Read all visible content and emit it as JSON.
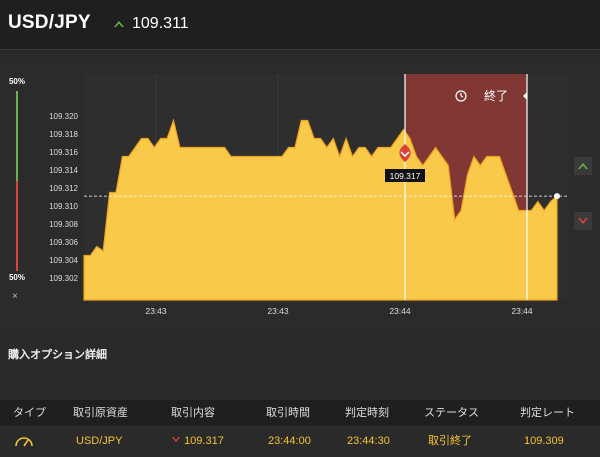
{
  "header": {
    "pair": "USD/JPY",
    "price": "109.311"
  },
  "gauge": {
    "top_label": "50%",
    "bottom_label": "50%",
    "close_glyph": "×"
  },
  "chart": {
    "y_ticks": [
      "109.320",
      "109.318",
      "109.316",
      "109.314",
      "109.312",
      "109.310",
      "109.308",
      "109.306",
      "109.304",
      "109.302"
    ],
    "x_ticks": [
      "23:43",
      "23:43",
      "23:44",
      "23:44"
    ],
    "entry_price_label": "109.317",
    "expiry_label": "終了",
    "colors": {
      "area": "#f9c94a",
      "area_stroke": "#f0a020",
      "expired_zone": "#8b3a36",
      "up": "#6ab04c",
      "down": "#d9443a"
    }
  },
  "chart_data": {
    "type": "area",
    "title": "",
    "xlabel": "",
    "ylabel": "",
    "ylim": [
      109.3,
      109.321
    ],
    "series": [
      {
        "values": [
          109.3045,
          109.3045,
          109.3055,
          109.305,
          109.3115,
          109.3115,
          109.3155,
          109.3155,
          109.3165,
          109.3175,
          109.3175,
          109.3165,
          109.3175,
          109.3175,
          109.3195,
          109.3165,
          109.3165,
          109.3165,
          109.3165,
          109.3165,
          109.3165,
          109.3165,
          109.3165,
          109.3155,
          109.3155,
          109.3155,
          109.3155,
          109.3155,
          109.3155,
          109.3155,
          109.3155,
          109.3155,
          109.3165,
          109.3165,
          109.3195,
          109.3195,
          109.3175,
          109.3175,
          109.3165,
          109.3175,
          109.3155,
          109.3175,
          109.3155,
          109.3165,
          109.3165,
          109.3155,
          109.3165,
          109.3165,
          109.3165,
          109.3175,
          109.3185,
          109.3175,
          109.3155,
          109.3145,
          109.3155,
          109.3165,
          109.3155,
          109.3145,
          109.3085,
          109.3095,
          109.3135,
          109.3155,
          109.3145,
          109.3155,
          109.3155,
          109.3155,
          109.3135,
          109.3115,
          109.3095,
          109.3095,
          109.3095,
          109.3105,
          109.3095,
          109.3105,
          109.3111
        ]
      }
    ]
  },
  "buttons": {
    "up_label": "High",
    "down_label": "Low"
  },
  "section": {
    "title": "購入オプション詳細"
  },
  "table": {
    "headers": [
      "タイプ",
      "取引原資産",
      "取引内容",
      "取引時間",
      "判定時刻",
      "ステータス",
      "判定レート"
    ],
    "row": {
      "asset": "USD/JPY",
      "direction_value": "109.317",
      "trade_time": "23:44:00",
      "judge_time": "23:44:30",
      "status": "取引終了",
      "judge_rate": "109.309"
    }
  }
}
